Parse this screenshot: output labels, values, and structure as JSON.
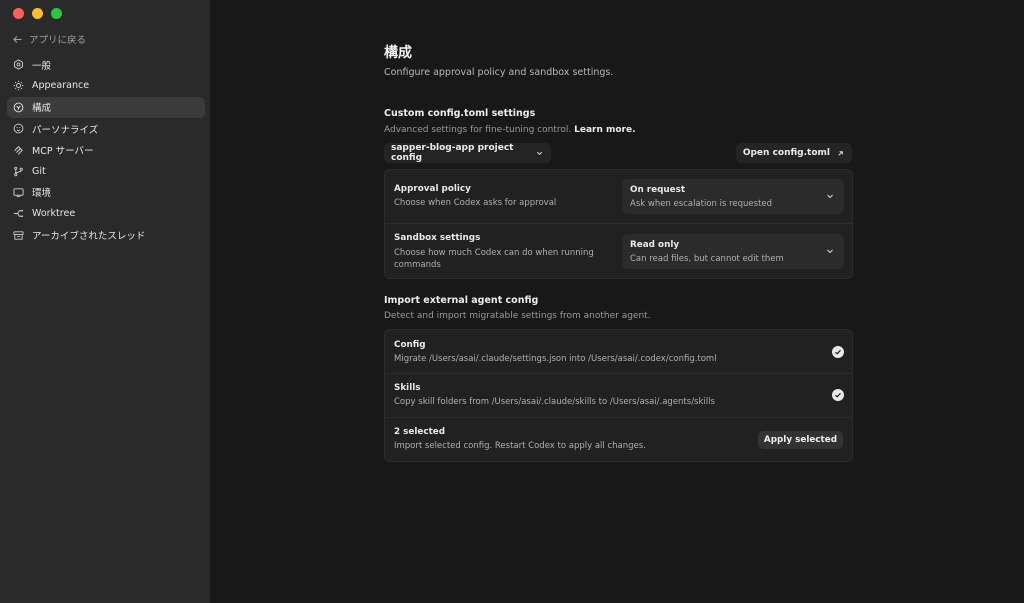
{
  "window": {
    "traffic_colors": [
      "#ff5f57",
      "#febc2e",
      "#28c840"
    ]
  },
  "sidebar": {
    "back_label": "アプリに戻る",
    "items": [
      {
        "label": "一般",
        "icon": "gear-icon",
        "active": false
      },
      {
        "label": "Appearance",
        "icon": "sun-icon",
        "active": false
      },
      {
        "label": "構成",
        "icon": "config-icon",
        "active": true
      },
      {
        "label": "パーソナライズ",
        "icon": "personalize-icon",
        "active": false
      },
      {
        "label": "MCP サーバー",
        "icon": "mcp-icon",
        "active": false
      },
      {
        "label": "Git",
        "icon": "git-branch-icon",
        "active": false
      },
      {
        "label": "環境",
        "icon": "monitor-icon",
        "active": false
      },
      {
        "label": "Worktree",
        "icon": "worktree-icon",
        "active": false
      },
      {
        "label": "アーカイブされたスレッド",
        "icon": "archive-icon",
        "active": false
      }
    ]
  },
  "main": {
    "title": "構成",
    "subtitle": "Configure approval policy and sandbox settings.",
    "custom": {
      "title": "Custom config.toml settings",
      "desc": "Advanced settings for fine-tuning control.",
      "learn_more": "Learn more.",
      "project_select": "sapper-blog-app project config",
      "open_button": "Open config.toml",
      "rows": [
        {
          "title": "Approval policy",
          "desc": "Choose when Codex asks for approval",
          "value_title": "On request",
          "value_desc": "Ask when escalation is requested"
        },
        {
          "title": "Sandbox settings",
          "desc_line1": "Choose how much Codex can do when running",
          "desc_line2": "commands",
          "value_title": "Read only",
          "value_desc": "Can read files, but cannot edit them"
        }
      ]
    },
    "import": {
      "title": "Import external agent config",
      "desc": "Detect and import migratable settings from another agent.",
      "rows": [
        {
          "title": "Config",
          "desc": "Migrate /Users/asai/.claude/settings.json into /Users/asai/.codex/config.toml",
          "checked": true
        },
        {
          "title": "Skills",
          "desc": "Copy skill folders from /Users/asai/.claude/skills to /Users/asai/.agents/skills",
          "checked": true
        }
      ],
      "summary_title": "2 selected",
      "summary_desc": "Import selected config. Restart Codex to apply all changes.",
      "apply_button": "Apply selected"
    }
  }
}
